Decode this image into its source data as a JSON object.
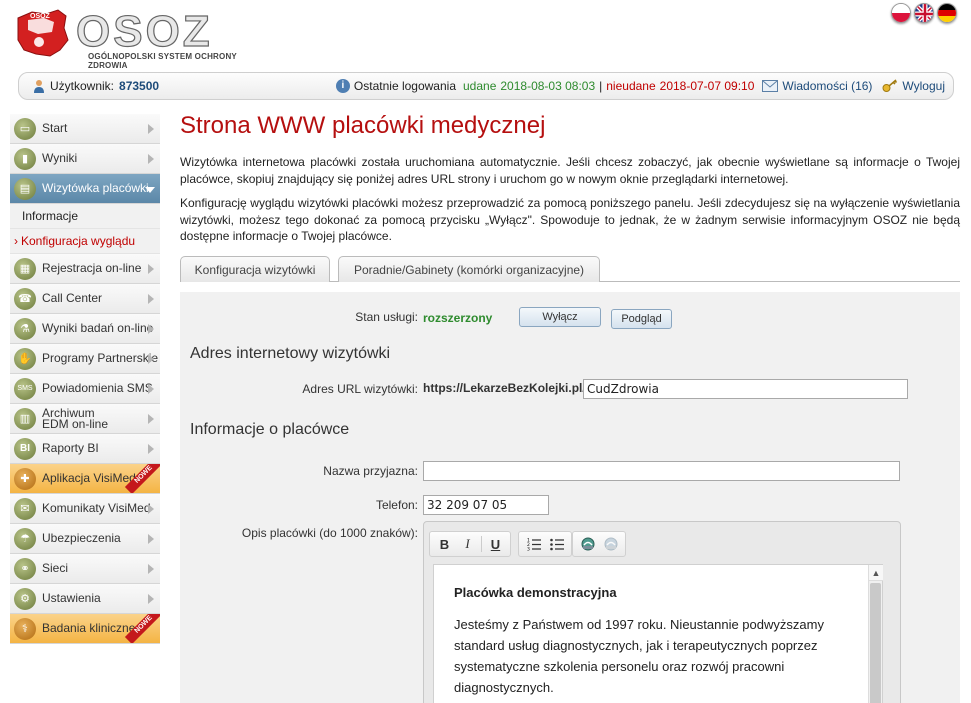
{
  "header": {
    "logo_text": "OSOZ",
    "logo_subtitle": "OGÓLNOPOLSKI SYSTEM OCHRONY ZDROWIA",
    "flags": [
      "pl-flag-icon",
      "uk-flag-icon",
      "de-flag-icon"
    ]
  },
  "status": {
    "user_label": "Użytkownik:",
    "user_id": "873500",
    "last_login_label": "Ostatnie logowania",
    "success_label": "udane",
    "success_time": "2018-08-03 08:03",
    "separator": "|",
    "failed_label": "nieudane",
    "failed_time": "2018-07-07 09:10",
    "messages_label": "Wiadomości (16)",
    "logout_label": "Wyloguj"
  },
  "sidebar": {
    "items": [
      {
        "label": "Start",
        "icon": "monitor-icon"
      },
      {
        "label": "Wyniki",
        "icon": "chart-icon"
      },
      {
        "label": "Wizytówka placówki",
        "icon": "card-icon"
      },
      {
        "label": "Rejestracja on-line",
        "icon": "calendar-icon"
      },
      {
        "label": "Call Center",
        "icon": "phone-icon"
      },
      {
        "label": "Wyniki badań on-line",
        "icon": "flask-icon"
      },
      {
        "label": "Programy Partnerskie",
        "icon": "handshake-icon"
      },
      {
        "label": "Powiadomienia SMS",
        "icon": "sms-icon"
      },
      {
        "label": "Archiwum EDM on-line",
        "icon": "archive-icon"
      },
      {
        "label": "Raporty BI",
        "icon": "bi-icon"
      },
      {
        "label": "Aplikacja VisiMed",
        "icon": "app-icon",
        "badge": "NOWE"
      },
      {
        "label": "Komunikaty VisiMed",
        "icon": "message-icon"
      },
      {
        "label": "Ubezpieczenia",
        "icon": "umbrella-icon"
      },
      {
        "label": "Sieci",
        "icon": "network-icon"
      },
      {
        "label": "Ustawienia",
        "icon": "gear-icon"
      },
      {
        "label": "Badania kliniczne",
        "icon": "clinical-icon",
        "badge": "NOWE"
      }
    ],
    "subitems": [
      "Informacje",
      "Konfiguracja wyglądu"
    ]
  },
  "main": {
    "title": "Strona WWW placówki medycznej",
    "para1": "Wizytówka internetowa placówki została uruchomiana automatycznie. Jeśli chcesz zobaczyć, jak obecnie wyświetlane są informacje o Twojej placówce, skopiuj znajdujący się poniżej adres URL strony i uruchom go w nowym oknie przeglądarki internetowej.",
    "para2": "Konfigurację wyglądu wizytówki placówki możesz przeprowadzić za pomocą poniższego panelu. Jeśli zdecydujesz się na wyłączenie wyświetlania wizytówki, możesz tego dokonać za pomocą przycisku „Wyłącz\". Spowoduje to jednak, że w żadnym serwisie informacyjnym OSOZ nie będą dostępne informacje o Twojej placówce.",
    "tabs": [
      "Konfiguracja wizytówki",
      "Poradnie/Gabinety (komórki organizacyjne)"
    ]
  },
  "form": {
    "service_label": "Stan usługi:",
    "service_value": "rozszerzony",
    "disable_button": "Wyłącz",
    "preview_button": "Podgląd",
    "section_address": "Adres internetowy wizytówki",
    "url_label": "Adres URL wizytówki:",
    "url_prefix": "https://LekarzeBezKolejki.pl/",
    "url_value": "CudZdrowia",
    "section_info": "Informacje o placówce",
    "name_label": "Nazwa przyjazna:",
    "name_value": "",
    "phone_label": "Telefon:",
    "phone_value": "32 209 07 05",
    "desc_label": "Opis placówki (do 1000 znaków):"
  },
  "editor": {
    "toolbar": [
      "bold-icon",
      "italic-icon",
      "underline-icon",
      "ordered-list-icon",
      "bullet-list-icon",
      "link-icon",
      "unlink-icon"
    ],
    "heading": "Placówka demonstracyjna",
    "body": "Jesteśmy z Państwem od 1997 roku. Nieustannie podwyższamy standard usług diagnostycznych, jak i terapeutycznych poprzez systematyczne szkolenia personelu oraz rozwój pracowni diagnostycznych."
  }
}
